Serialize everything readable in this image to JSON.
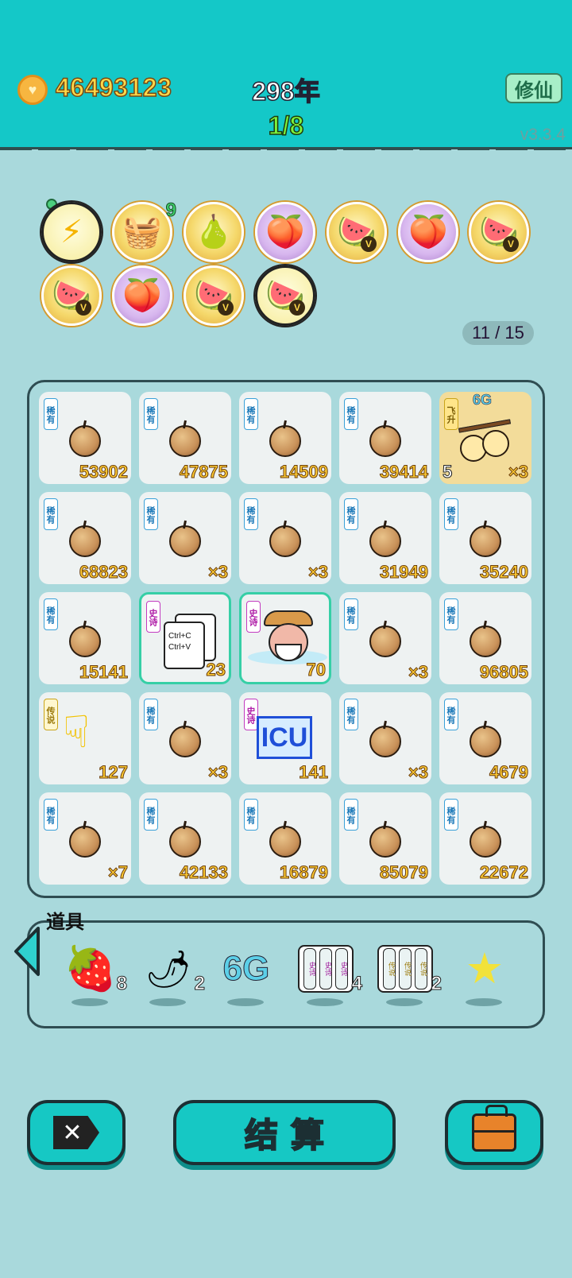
{
  "header": {
    "coins": "46493123",
    "year": "298年",
    "progress": "1/8",
    "cultivate_label": "修仙",
    "version": "v3.3.4"
  },
  "badges": {
    "basket_count": "9",
    "slots": "11 / 15",
    "items": [
      {
        "icon": "lightning-icon"
      },
      {
        "icon": "fruit-basket-icon"
      },
      {
        "icon": "pomelo-icon"
      },
      {
        "icon": "twin-fruit-icon"
      },
      {
        "icon": "fruit-platter-icon"
      },
      {
        "icon": "twin-fruit-icon"
      },
      {
        "icon": "fruit-platter-icon"
      },
      {
        "icon": "fruit-platter-icon"
      },
      {
        "icon": "twin-fruit-icon"
      },
      {
        "icon": "fruit-platter-icon"
      },
      {
        "icon": "fruit-platter-icon"
      }
    ],
    "v_mark": "V"
  },
  "grid": {
    "tag_rare": "稀有",
    "tag_epic": "史诗",
    "tag_legend": "传说",
    "tag_fly": "飞升",
    "cells": [
      {
        "tag": "rare",
        "value": "53902"
      },
      {
        "tag": "rare",
        "value": "47875"
      },
      {
        "tag": "rare",
        "value": "14509"
      },
      {
        "tag": "rare",
        "value": "39414"
      },
      {
        "tag": "fly",
        "value": "×3",
        "level": "5",
        "extra": "6G"
      },
      {
        "tag": "rare",
        "value": "68823"
      },
      {
        "tag": "rare",
        "value": "×3"
      },
      {
        "tag": "rare",
        "value": "×3"
      },
      {
        "tag": "rare",
        "value": "31949"
      },
      {
        "tag": "rare",
        "value": "35240"
      },
      {
        "tag": "rare",
        "value": "15141"
      },
      {
        "tag": "epic",
        "value": "23",
        "card_text": "Ctrl+C\nCtrl+V"
      },
      {
        "tag": "epic",
        "value": "70"
      },
      {
        "tag": "rare",
        "value": "×3"
      },
      {
        "tag": "rare",
        "value": "96805"
      },
      {
        "tag": "legend",
        "value": "127"
      },
      {
        "tag": "rare",
        "value": "×3"
      },
      {
        "tag": "epic",
        "value": "141",
        "icu": "ICU"
      },
      {
        "tag": "rare",
        "value": "×3"
      },
      {
        "tag": "rare",
        "value": "4679"
      },
      {
        "tag": "rare",
        "value": "×7"
      },
      {
        "tag": "rare",
        "value": "42133"
      },
      {
        "tag": "rare",
        "value": "16879"
      },
      {
        "tag": "rare",
        "value": "85079"
      },
      {
        "tag": "rare",
        "value": "22672"
      }
    ]
  },
  "items": {
    "title": "道具",
    "list": [
      {
        "icon": "strawberry-icon",
        "count": "8"
      },
      {
        "icon": "chili-icon",
        "count": "2"
      },
      {
        "icon": "6g-icon",
        "label": "6G",
        "count": ""
      },
      {
        "icon": "epic-scroll-icon",
        "count": "4"
      },
      {
        "icon": "legend-scroll-icon",
        "count": "2"
      },
      {
        "icon": "star-icon",
        "count": ""
      }
    ]
  },
  "buttons": {
    "settle_label": "结算"
  },
  "colors": {
    "background": "#a9d9dc",
    "header": "#14c8c8",
    "accent": "#16c8c4",
    "number_gold": "#ffcc33"
  }
}
